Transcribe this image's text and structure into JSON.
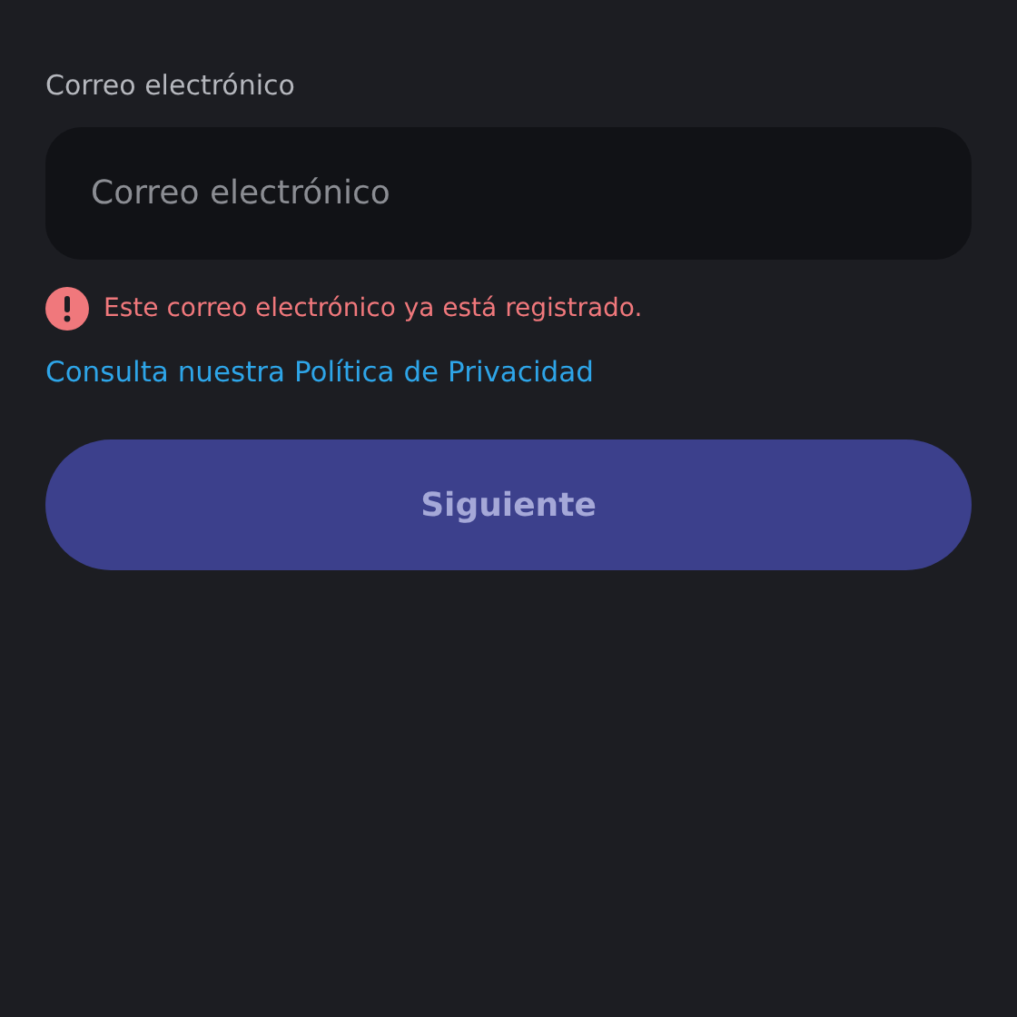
{
  "email_field": {
    "label": "Correo electrónico",
    "placeholder": "Correo electrónico"
  },
  "error": {
    "message": "Este correo electrónico ya está registrado."
  },
  "privacy_link": "Consulta nuestra Política de Privacidad",
  "next_button": {
    "label": "Siguiente",
    "disabled": true
  }
}
